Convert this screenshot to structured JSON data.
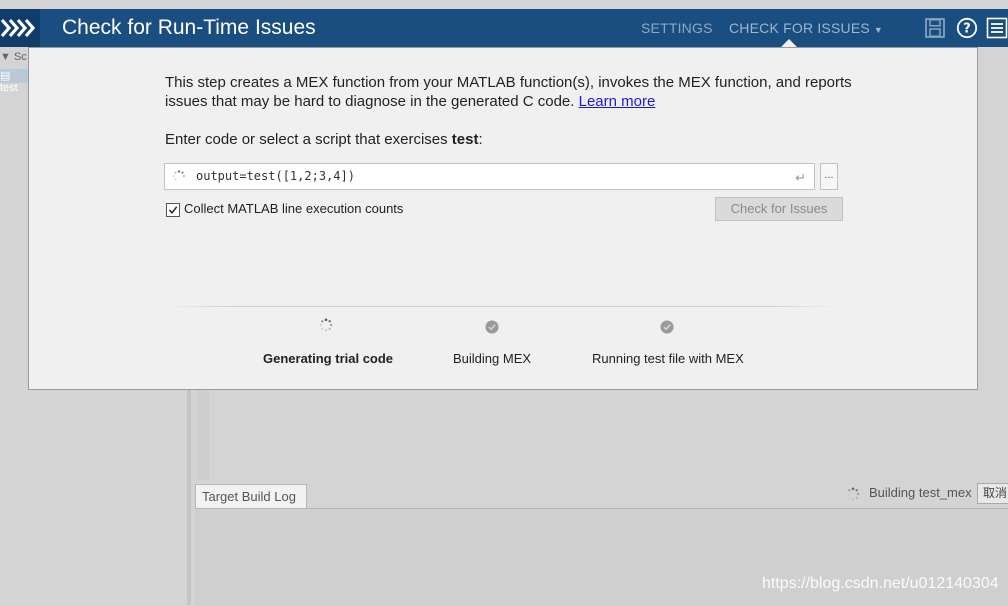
{
  "header": {
    "title": "Check for Run-Time Issues",
    "nav": {
      "settings": "SETTINGS",
      "check": "CHECK FOR ISSUES"
    }
  },
  "tree": {
    "row1": "Sc",
    "row2": "test"
  },
  "dialog": {
    "description_pre": "This step creates a MEX function from your MATLAB function(s), invokes the MEX function, and reports issues that may be hard to diagnose in the generated C code.",
    "learn_more": "Learn more",
    "prompt": "Enter code or select a script that exercises ",
    "function_name": "test",
    "prompt_suffix": ":",
    "code": "output=test([1,2;3,4])",
    "browse_label": "...",
    "collect_label": "Collect MATLAB line execution counts",
    "check_button": "Check for Issues",
    "steps": [
      {
        "label": "Generating trial code",
        "state": "active"
      },
      {
        "label": "Building MEX",
        "state": "pending"
      },
      {
        "label": "Running test file with MEX",
        "state": "pending"
      }
    ]
  },
  "log": {
    "tab": "Target Build Log",
    "status": "Building test_mex",
    "cancel": "取消"
  },
  "watermark": "https://blog.csdn.net/u012140304"
}
